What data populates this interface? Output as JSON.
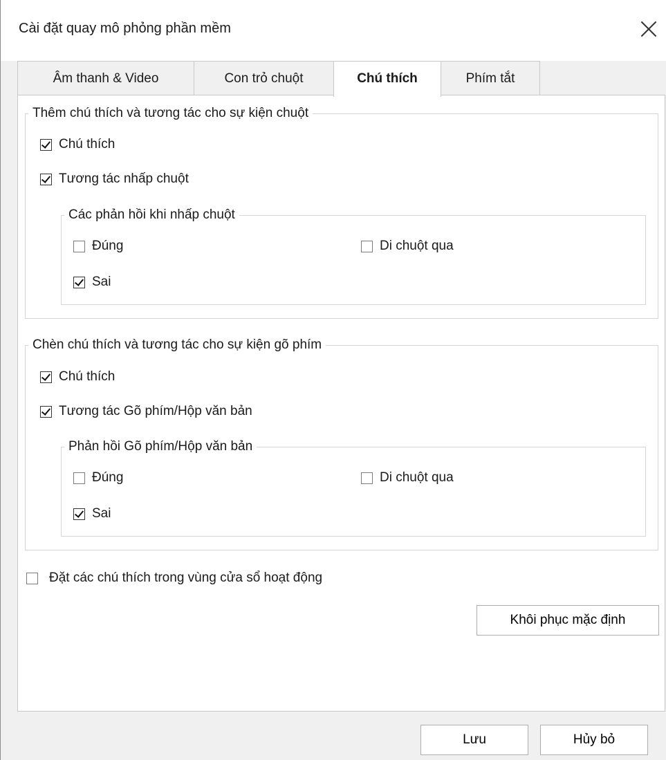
{
  "window": {
    "title": "Cài đặt quay mô phỏng phần mềm",
    "close_icon": "close-icon"
  },
  "tabs": [
    {
      "label": "Âm thanh & Video",
      "active": false
    },
    {
      "label": "Con trỏ chuột",
      "active": false
    },
    {
      "label": "Chú thích",
      "active": true
    },
    {
      "label": "Phím tắt",
      "active": false
    }
  ],
  "mouse_group": {
    "legend": "Thêm chú thích và tương tác cho sự kiện chuột",
    "caption_label": "Chú thích",
    "caption_checked": true,
    "click_label": "Tương tác nhấp chuột",
    "click_checked": true,
    "feedback": {
      "legend": "Các phản hồi khi nhấp chuột",
      "correct_label": "Đúng",
      "correct_checked": false,
      "hover_label": "Di chuột qua",
      "hover_checked": false,
      "wrong_label": "Sai",
      "wrong_checked": true
    }
  },
  "key_group": {
    "legend": "Chèn chú thích và tương tác cho sự kiện gõ phím",
    "caption_label": "Chú thích",
    "caption_checked": true,
    "typing_label": "Tương tác Gõ phím/Hộp văn bản",
    "typing_checked": true,
    "feedback": {
      "legend": "Phản hồi Gõ phím/Hộp văn bản",
      "correct_label": "Đúng",
      "correct_checked": false,
      "hover_label": "Di chuột qua",
      "hover_checked": false,
      "wrong_label": "Sai",
      "wrong_checked": true
    }
  },
  "place_in_window": {
    "label": "Đặt các chú thích trong vùng cửa sổ hoạt động",
    "checked": false
  },
  "buttons": {
    "restore_defaults": "Khôi phục mặc định",
    "save": "Lưu",
    "cancel": "Hủy bỏ"
  }
}
